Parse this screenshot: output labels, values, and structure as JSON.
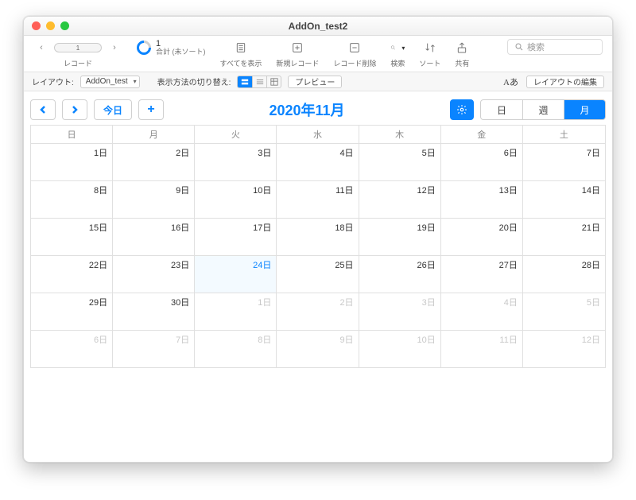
{
  "window": {
    "title": "AddOn_test2"
  },
  "toolbar1": {
    "record_value": "1",
    "record_label": "レコード",
    "total_count": "1",
    "total_label": "合計 (未ソート)",
    "show_all": "すべてを表示",
    "new_record": "新規レコード",
    "delete_record": "レコード削除",
    "search": "検索",
    "sort": "ソート",
    "share": "共有",
    "search_placeholder": "検索"
  },
  "toolbar2": {
    "layout_label": "レイアウト:",
    "layout_value": "AddOn_test",
    "view_switch_label": "表示方法の切り替え:",
    "preview": "プレビュー",
    "text_size": "Aあ",
    "edit_layout": "レイアウトの編集"
  },
  "calendar": {
    "today_label": "今日",
    "title": "2020年11月",
    "views": {
      "day": "日",
      "week": "週",
      "month": "月"
    },
    "active_view": "month",
    "dow": [
      "日",
      "月",
      "火",
      "水",
      "木",
      "金",
      "土"
    ],
    "cells": [
      {
        "t": "1日"
      },
      {
        "t": "2日"
      },
      {
        "t": "3日"
      },
      {
        "t": "4日"
      },
      {
        "t": "5日"
      },
      {
        "t": "6日"
      },
      {
        "t": "7日"
      },
      {
        "t": "8日"
      },
      {
        "t": "9日"
      },
      {
        "t": "10日"
      },
      {
        "t": "11日"
      },
      {
        "t": "12日"
      },
      {
        "t": "13日"
      },
      {
        "t": "14日"
      },
      {
        "t": "15日"
      },
      {
        "t": "16日"
      },
      {
        "t": "17日"
      },
      {
        "t": "18日"
      },
      {
        "t": "19日"
      },
      {
        "t": "20日"
      },
      {
        "t": "21日"
      },
      {
        "t": "22日"
      },
      {
        "t": "23日"
      },
      {
        "t": "24日",
        "today": true
      },
      {
        "t": "25日"
      },
      {
        "t": "26日"
      },
      {
        "t": "27日"
      },
      {
        "t": "28日"
      },
      {
        "t": "29日"
      },
      {
        "t": "30日"
      },
      {
        "t": "1日",
        "out": true
      },
      {
        "t": "2日",
        "out": true
      },
      {
        "t": "3日",
        "out": true
      },
      {
        "t": "4日",
        "out": true
      },
      {
        "t": "5日",
        "out": true
      },
      {
        "t": "6日",
        "out": true
      },
      {
        "t": "7日",
        "out": true
      },
      {
        "t": "8日",
        "out": true
      },
      {
        "t": "9日",
        "out": true
      },
      {
        "t": "10日",
        "out": true
      },
      {
        "t": "11日",
        "out": true
      },
      {
        "t": "12日",
        "out": true
      }
    ]
  }
}
